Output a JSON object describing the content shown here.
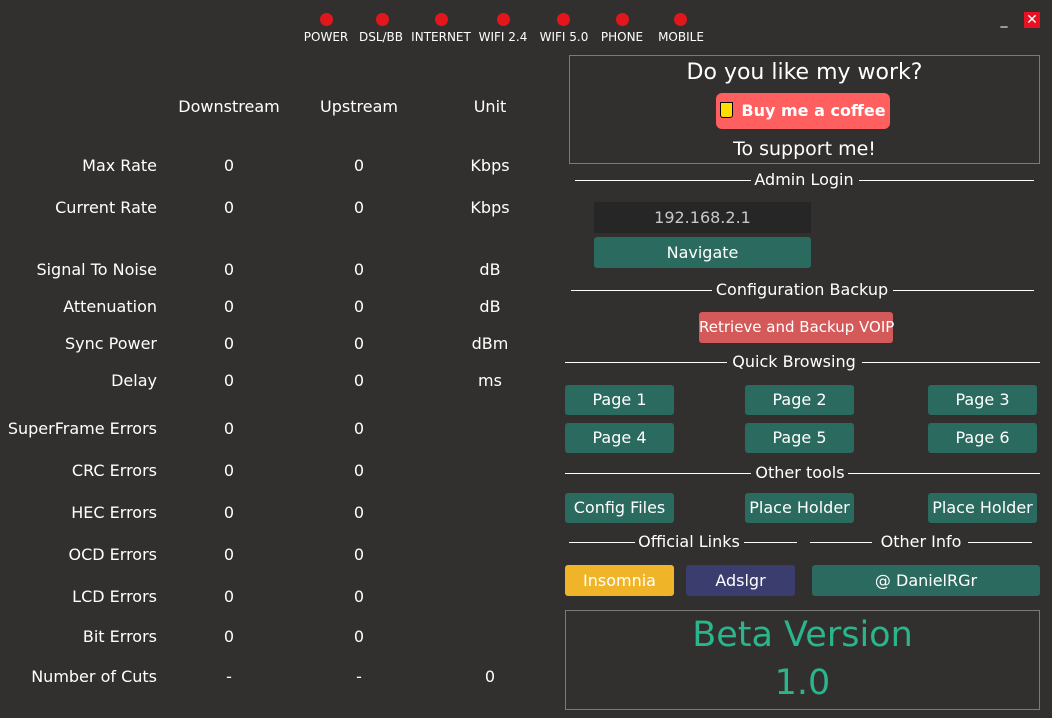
{
  "window": {
    "minimize_label": "_",
    "close_label": "✕"
  },
  "leds": [
    {
      "label": "POWER",
      "color": "#e2161d"
    },
    {
      "label": "DSL/BB",
      "color": "#e2161d"
    },
    {
      "label": "INTERNET",
      "color": "#e2161d"
    },
    {
      "label": "WIFI 2.4",
      "color": "#e2161d"
    },
    {
      "label": "WIFI 5.0",
      "color": "#e2161d"
    },
    {
      "label": "PHONE",
      "color": "#e2161d"
    },
    {
      "label": "MOBILE",
      "color": "#e2161d"
    }
  ],
  "stats": {
    "headers": [
      "Downstream",
      "Upstream",
      "Unit"
    ],
    "rows": [
      {
        "label": "Max Rate",
        "down": "0",
        "up": "0",
        "unit": "Kbps"
      },
      {
        "label": "Current Rate",
        "down": "0",
        "up": "0",
        "unit": "Kbps"
      },
      {
        "label": "Signal To Noise",
        "down": "0",
        "up": "0",
        "unit": "dB"
      },
      {
        "label": "Attenuation",
        "down": "0",
        "up": "0",
        "unit": "dB"
      },
      {
        "label": "Sync Power",
        "down": "0",
        "up": "0",
        "unit": "dBm"
      },
      {
        "label": "Delay",
        "down": "0",
        "up": "0",
        "unit": "ms"
      },
      {
        "label": "SuperFrame Errors",
        "down": "0",
        "up": "0",
        "unit": ""
      },
      {
        "label": "CRC Errors",
        "down": "0",
        "up": "0",
        "unit": ""
      },
      {
        "label": "HEC Errors",
        "down": "0",
        "up": "0",
        "unit": ""
      },
      {
        "label": "OCD Errors",
        "down": "0",
        "up": "0",
        "unit": ""
      },
      {
        "label": "LCD Errors",
        "down": "0",
        "up": "0",
        "unit": ""
      },
      {
        "label": "Bit Errors",
        "down": "0",
        "up": "0",
        "unit": ""
      },
      {
        "label": "Number of Cuts",
        "down": "-",
        "up": "-",
        "unit": "0"
      }
    ]
  },
  "donate": {
    "title": "Do you like my work?",
    "button_label": "Buy me a coffee",
    "subtitle": "To support me!"
  },
  "admin": {
    "section_title": "Admin Login",
    "ip_value": "192.168.2.1",
    "navigate_label": "Navigate"
  },
  "backup": {
    "section_title": "Configuration Backup",
    "button_label": "Retrieve and Backup VOIP"
  },
  "quick": {
    "section_title": "Quick Browsing",
    "pages": [
      "Page 1",
      "Page 2",
      "Page 3",
      "Page 4",
      "Page 5",
      "Page 6"
    ]
  },
  "tools": {
    "section_title": "Other tools",
    "buttons": [
      "Config Files",
      "Place Holder",
      "Place Holder"
    ]
  },
  "links": {
    "section_title": "Official Links",
    "insomnia_label": "Insomnia",
    "adslgr_label": "Adslgr"
  },
  "info": {
    "section_title": "Other Info",
    "author_label": "@ DanielRGr"
  },
  "beta": {
    "line1": "Beta Version",
    "line2": "1.0"
  },
  "colors": {
    "background": "#31302e",
    "led_off": "#e2161d",
    "button_green": "#2b6b5f",
    "button_red": "#d45a5a",
    "button_yellow": "#f0b429",
    "button_navy": "#3a3d6e",
    "coffee": "#ff5f5f",
    "beta_text": "#2bb58c"
  }
}
